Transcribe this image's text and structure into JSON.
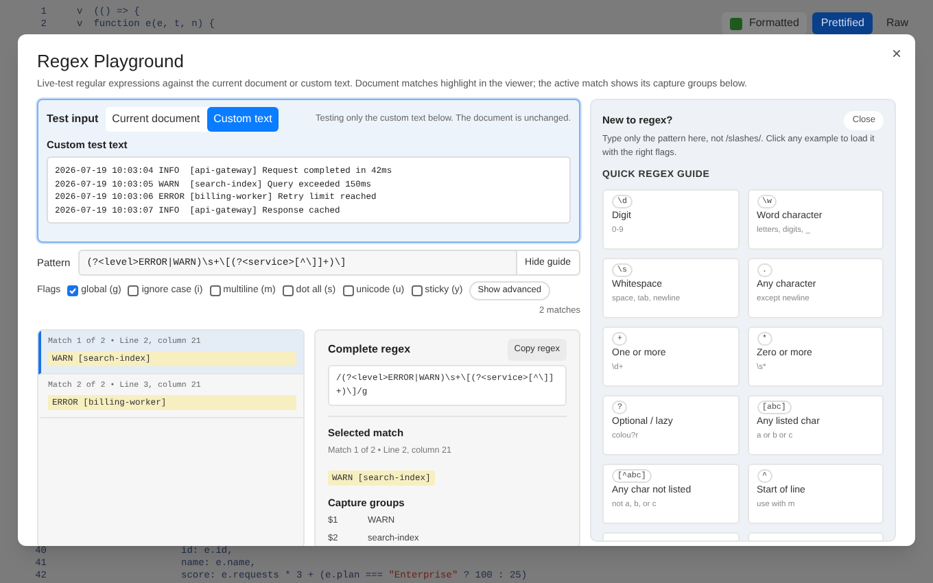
{
  "background": {
    "code_top": [
      {
        "number": "1",
        "fold": "v",
        "code": "(() => {"
      },
      {
        "number": "2",
        "fold": "v",
        "code": "function e(e, t, n) {"
      }
    ],
    "toolbar": {
      "formatted": {
        "label": "Formatted",
        "checked": true
      },
      "views": [
        {
          "label": "Prettified",
          "selected": true
        },
        {
          "label": "Raw",
          "selected": false
        }
      ]
    },
    "code_bottom": [
      {
        "number": "40",
        "code": "id: e.id,"
      },
      {
        "number": "41",
        "code": "name: e.name,"
      },
      {
        "number": "42",
        "code": "score: e.requests * 3 + (e.plan === ",
        "string": "\"Enterprise\"",
        "rest": " ? 100 : 25)"
      }
    ]
  },
  "modal": {
    "title": "Regex Playground",
    "close": "×",
    "description": "Live-test regular expressions against the current document or custom text. Document matches highlight in the viewer; the active match shows its capture groups below.",
    "test_input": {
      "label": "Test input",
      "sources": [
        {
          "label": "Current document",
          "selected": false
        },
        {
          "label": "Custom text",
          "selected": true
        }
      ],
      "note": "Testing only the custom text below. The document is unchanged.",
      "text_label": "Custom test text",
      "text": "2026-07-19 10:03:04 INFO  [api-gateway] Request completed in 42ms\n2026-07-19 10:03:05 WARN  [search-index] Query exceeded 150ms\n2026-07-19 10:03:06 ERROR [billing-worker] Retry limit reached\n2026-07-19 10:03:07 INFO  [api-gateway] Response cached"
    },
    "pattern": {
      "label": "Pattern",
      "value": "(?<level>ERROR|WARN)\\s+\\[(?<service>[^\\]]+)\\]",
      "guide_button": "Hide guide"
    },
    "flags": {
      "label": "Flags",
      "items": [
        {
          "label": "global (g)",
          "checked": true
        },
        {
          "label": "ignore case (i)",
          "checked": false
        },
        {
          "label": "multiline (m)",
          "checked": false
        },
        {
          "label": "dot all (s)",
          "checked": false
        },
        {
          "label": "unicode (u)",
          "checked": false
        },
        {
          "label": "sticky (y)",
          "checked": false
        }
      ],
      "advanced_button": "Show advanced"
    },
    "match_count": "2 matches",
    "matches": [
      {
        "location": "Match 1 of 2 • Line 2, column 21",
        "text": "WARN  [search-index]",
        "selected": true
      },
      {
        "location": "Match 2 of 2 • Line 3, column 21",
        "text": "ERROR [billing-worker]",
        "selected": false
      }
    ],
    "complete": {
      "title": "Complete regex",
      "copy_button": "Copy regex",
      "regex": "/(?<level>ERROR|WARN)\\s+\\[(?<service>[^\\]]+)\\]/g"
    },
    "selected_match": {
      "title": "Selected match",
      "location": "Match 1 of 2 • Line 2, column 21",
      "text": "WARN  [search-index]"
    },
    "capture_groups": {
      "title": "Capture groups",
      "rows": [
        {
          "name": "$1",
          "value": "WARN"
        },
        {
          "name": "$2",
          "value": "search-index"
        }
      ]
    },
    "guide": {
      "title": "New to regex?",
      "close": "Close",
      "intro": "Type only the pattern here, not /slashes/. Click any example to load it with the right flags.",
      "heading": "QUICK REGEX GUIDE",
      "cards": [
        {
          "token": "\\d",
          "name": "Digit",
          "example": "0-9"
        },
        {
          "token": "\\w",
          "name": "Word character",
          "example": "letters, digits, _"
        },
        {
          "token": "\\s",
          "name": "Whitespace",
          "example": "space, tab, newline"
        },
        {
          "token": ".",
          "name": "Any character",
          "example": "except newline"
        },
        {
          "token": "+",
          "name": "One or more",
          "example": "\\d+"
        },
        {
          "token": "*",
          "name": "Zero or more",
          "example": "\\s*"
        },
        {
          "token": "?",
          "name": "Optional / lazy",
          "example": "colou?r"
        },
        {
          "token": "[abc]",
          "name": "Any listed char",
          "example": "a or b or c"
        },
        {
          "token": "[^abc]",
          "name": "Any char not listed",
          "example": "not a, b, or c"
        },
        {
          "token": "^",
          "name": "Start of line",
          "example": "use with m"
        }
      ]
    }
  }
}
